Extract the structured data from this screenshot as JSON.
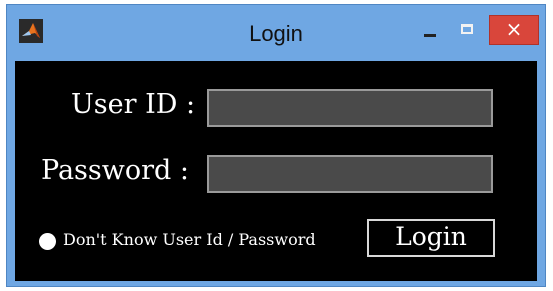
{
  "window": {
    "title": "Login",
    "app_icon": "matlab-icon",
    "controls": {
      "minimize": "minimize-icon",
      "maximize": "maximize-icon",
      "close": "×"
    },
    "colors": {
      "frame": "#6fa7e3",
      "client": "#000000",
      "close": "#d9463b",
      "text": "#ffffff"
    }
  },
  "form": {
    "user_id_label": "User ID :",
    "user_id_value": "",
    "password_label": "Password :",
    "password_value": "",
    "forgot_label": "Don't Know User Id / Password",
    "login_label": "Login"
  }
}
